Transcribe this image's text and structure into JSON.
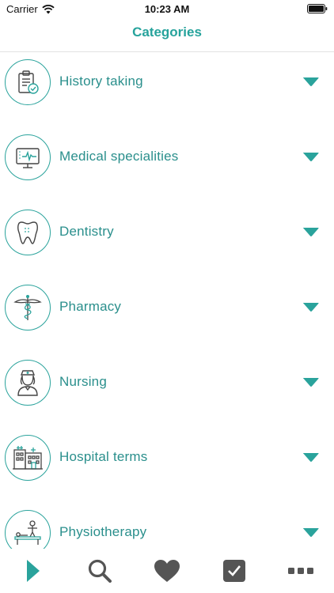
{
  "status_bar": {
    "carrier": "Carrier",
    "time": "10:23 AM"
  },
  "nav": {
    "title": "Categories"
  },
  "categories": [
    {
      "label": "History taking",
      "icon": "clipboard-check-icon"
    },
    {
      "label": "Medical specialities",
      "icon": "monitor-heartbeat-icon"
    },
    {
      "label": "Dentistry",
      "icon": "tooth-icon"
    },
    {
      "label": "Pharmacy",
      "icon": "caduceus-icon"
    },
    {
      "label": "Nursing",
      "icon": "nurse-icon"
    },
    {
      "label": "Hospital terms",
      "icon": "hospital-building-icon"
    },
    {
      "label": "Physiotherapy",
      "icon": "physiotherapy-icon"
    }
  ],
  "tab_bar": {
    "items": [
      {
        "name": "play",
        "icon": "play-icon"
      },
      {
        "name": "search",
        "icon": "search-icon"
      },
      {
        "name": "favorites",
        "icon": "heart-icon"
      },
      {
        "name": "tasks",
        "icon": "checkbox-icon"
      },
      {
        "name": "more",
        "icon": "more-icon"
      }
    ]
  },
  "colors": {
    "accent": "#2aa39c",
    "label": "#2a8f8c",
    "tab_icon": "#555555"
  }
}
